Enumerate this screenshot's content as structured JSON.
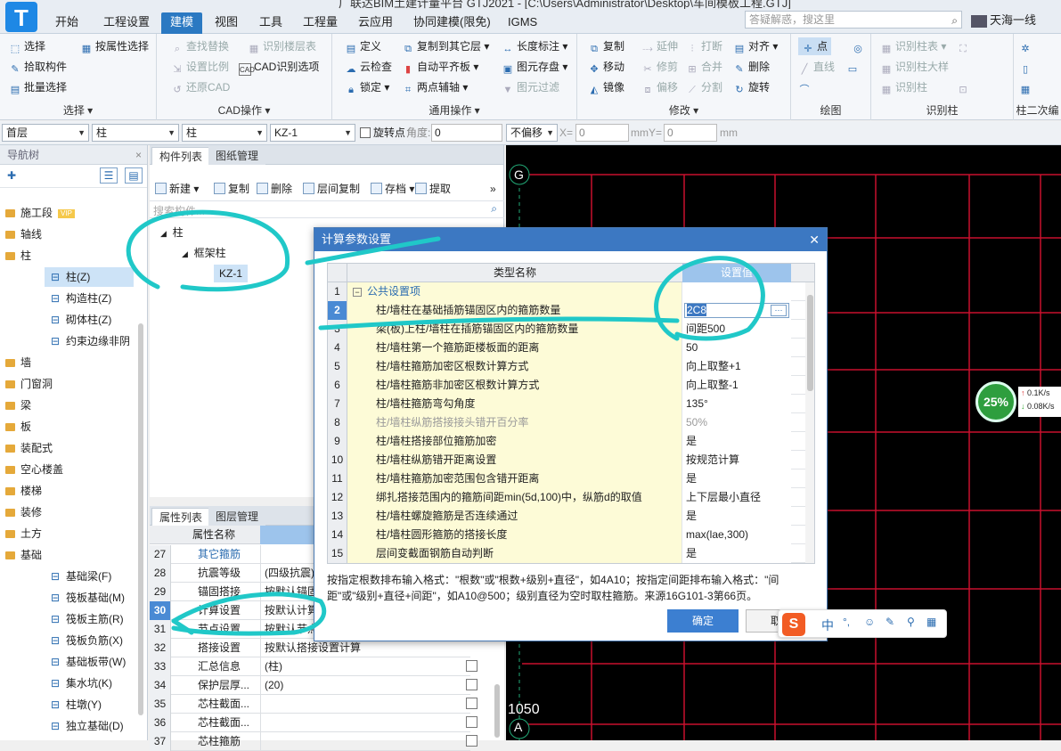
{
  "window": {
    "title": "广联达BIM土建计量平台 GTJ2021 - [C:\\Users\\Administrator\\Desktop\\车间模板工程.GTJ]",
    "app_logo": "T"
  },
  "menu": {
    "tabs": [
      "开始",
      "工程设置",
      "建模",
      "视图",
      "工具",
      "工程量",
      "云应用",
      "协同建模(限免)",
      "IGMS"
    ],
    "active": "建模"
  },
  "search": {
    "placeholder": "答疑解惑，搜这里"
  },
  "user": {
    "name": "天海一线"
  },
  "ribbon": {
    "select": {
      "label": "选择",
      "items": [
        "选择",
        "按属性选择",
        "拾取构件",
        "批量选择"
      ]
    },
    "cad": {
      "label": "CAD操作",
      "items": [
        "查找替换",
        "识别楼层表",
        "设置比例",
        "CAD识别选项",
        "还原CAD"
      ]
    },
    "common": {
      "label": "通用操作",
      "items": [
        "定义",
        "复制到其它层",
        "长度标注",
        "云检查",
        "自动平齐板",
        "图元存盘",
        "锁定",
        "两点辅轴",
        "图元过滤"
      ]
    },
    "modify": {
      "label": "修改",
      "items": [
        "复制",
        "延伸",
        "打断",
        "对齐",
        "移动",
        "修剪",
        "合并",
        "删除",
        "镜像",
        "偏移",
        "分割",
        "旋转"
      ]
    },
    "draw": {
      "label": "绘图",
      "items": [
        "点",
        "直线"
      ]
    },
    "identify": {
      "label": "识别柱",
      "items": [
        "识别柱表",
        "识别柱大样",
        "识别柱"
      ]
    },
    "col2": {
      "label": "柱二次编"
    }
  },
  "combobar": {
    "floor": "首层",
    "type1": "柱",
    "type2": "柱",
    "comp": "KZ-1",
    "rotate_label": "旋转点",
    "angle_label": "角度:",
    "angle": "0",
    "offset": "不偏移",
    "x_label": "X=",
    "x": "0",
    "mm_y": "mmY=",
    "y": "0",
    "mm": "mm"
  },
  "navtree": {
    "title": "导航树",
    "items": [
      {
        "label": "施工段",
        "vip": "VIP"
      },
      {
        "label": "轴线"
      },
      {
        "label": "柱"
      },
      {
        "label": "柱(Z)",
        "icon": "column-icon",
        "sub": true,
        "selected": true
      },
      {
        "label": "构造柱(Z)",
        "icon": "construct-column-icon",
        "sub": true
      },
      {
        "label": "砌体柱(Z)",
        "icon": "masonry-column-icon",
        "sub": true
      },
      {
        "label": "约束边缘非阴",
        "icon": "edge-column-icon",
        "sub": true
      },
      {
        "label": "墙"
      },
      {
        "label": "门窗洞"
      },
      {
        "label": "梁"
      },
      {
        "label": "板"
      },
      {
        "label": "装配式"
      },
      {
        "label": "空心楼盖"
      },
      {
        "label": "楼梯"
      },
      {
        "label": "装修"
      },
      {
        "label": "土方"
      },
      {
        "label": "基础"
      },
      {
        "label": "基础梁(F)",
        "icon": "foundation-beam-icon",
        "sub": true
      },
      {
        "label": "筏板基础(M)",
        "icon": "raft-foundation-icon",
        "sub": true
      },
      {
        "label": "筏板主筋(R)",
        "icon": "raft-main-rebar-icon",
        "sub": true
      },
      {
        "label": "筏板负筋(X)",
        "icon": "raft-neg-rebar-icon",
        "sub": true
      },
      {
        "label": "基础板带(W)",
        "icon": "foundation-strip-icon",
        "sub": true
      },
      {
        "label": "集水坑(K)",
        "icon": "sump-icon",
        "sub": true
      },
      {
        "label": "柱墩(Y)",
        "icon": "column-pier-icon",
        "sub": true
      },
      {
        "label": "独立基础(D)",
        "icon": "isolated-footing-icon",
        "sub": true
      }
    ]
  },
  "components": {
    "tabs": [
      "构件列表",
      "图纸管理"
    ],
    "toolbar": [
      "新建",
      "复制",
      "删除",
      "层间复制",
      "存档",
      "提取"
    ],
    "search_placeholder": "搜索构件...",
    "tree": {
      "root": "柱",
      "child": "框架柱",
      "leaf": "KZ-1"
    }
  },
  "props": {
    "tabs": [
      "属性列表",
      "图层管理"
    ],
    "header": "属性名称",
    "rows": [
      {
        "n": "27",
        "k": "其它箍筋",
        "v": "",
        "link": true
      },
      {
        "n": "28",
        "k": "抗震等级",
        "v": "(四级抗震)"
      },
      {
        "n": "29",
        "k": "锚固搭接",
        "v": "按默认锚固"
      },
      {
        "n": "30",
        "k": "计算设置",
        "v": "按默认计算",
        "selected": true
      },
      {
        "n": "31",
        "k": "节点设置",
        "v": "按默认节点"
      },
      {
        "n": "32",
        "k": "搭接设置",
        "v": "按默认搭接设置计算"
      },
      {
        "n": "33",
        "k": "汇总信息",
        "v": "(柱)",
        "check": true
      },
      {
        "n": "34",
        "k": "保护层厚...",
        "v": "(20)",
        "check": true
      },
      {
        "n": "35",
        "k": "芯柱截面...",
        "v": "",
        "check": true
      },
      {
        "n": "36",
        "k": "芯柱截面...",
        "v": "",
        "check": true
      },
      {
        "n": "37",
        "k": "芯柱箍筋",
        "v": "",
        "check": true
      }
    ]
  },
  "canvas": {
    "axis_top": "G",
    "axis_bottom": "A",
    "dim_label": "1050"
  },
  "dialog": {
    "title": "计算参数设置",
    "col_name": "类型名称",
    "col_value": "设置值",
    "rows": [
      {
        "n": "1",
        "k": "公共设置项",
        "v": "",
        "group": true
      },
      {
        "n": "2",
        "k": "柱/墙柱在基础插筋锚固区内的箍筋数量",
        "v": "2C8",
        "selected": true
      },
      {
        "n": "3",
        "k": "梁(板)上柱/墙柱在插筋锚固区内的箍筋数量",
        "v": "间距500"
      },
      {
        "n": "4",
        "k": "柱/墙柱第一个箍筋距楼板面的距离",
        "v": "50"
      },
      {
        "n": "5",
        "k": "柱/墙柱箍筋加密区根数计算方式",
        "v": "向上取整+1"
      },
      {
        "n": "6",
        "k": "柱/墙柱箍筋非加密区根数计算方式",
        "v": "向上取整-1"
      },
      {
        "n": "7",
        "k": "柱/墙柱箍筋弯勾角度",
        "v": "135°"
      },
      {
        "n": "8",
        "k": "柱/墙柱纵筋搭接接头错开百分率",
        "v": "50%",
        "grey": true
      },
      {
        "n": "9",
        "k": "柱/墙柱搭接部位箍筋加密",
        "v": "是"
      },
      {
        "n": "10",
        "k": "柱/墙柱纵筋错开距离设置",
        "v": "按规范计算"
      },
      {
        "n": "11",
        "k": "柱/墙柱箍筋加密范围包含错开距离",
        "v": "是"
      },
      {
        "n": "12",
        "k": "绑扎搭接范围内的箍筋间距min(5d,100)中，纵筋d的取值",
        "v": "上下层最小直径"
      },
      {
        "n": "13",
        "k": "柱/墙柱螺旋箍筋是否连续通过",
        "v": "是"
      },
      {
        "n": "14",
        "k": "层间变截面钢筋自动判断",
        "v": "max(lae,300)",
        "k_override": "柱/墙柱圆形箍筋的搭接长度"
      },
      {
        "n": "15",
        "k": "层间变截面钢筋自动判断",
        "v": "是"
      }
    ],
    "hint": "按指定根数排布输入格式：\"根数\"或\"根数+级别+直径\"，如4A10；按指定间距排布输入格式：\"间距\"或\"级别+直径+间距\"，如A10@500；级别直径为空时取柱箍筋。来源16G101-3第66页。",
    "ok": "确定",
    "cancel": "取消"
  },
  "network": {
    "percent": "25%",
    "up": "0.1K/s",
    "down": "0.08K/s"
  },
  "ime": {
    "logo": "S",
    "lang": "中"
  },
  "colors": {
    "accent": "#2b79c2",
    "canvas_bg": "#000000",
    "grid_line": "#c8102e",
    "annotation": "#20c8c8"
  }
}
